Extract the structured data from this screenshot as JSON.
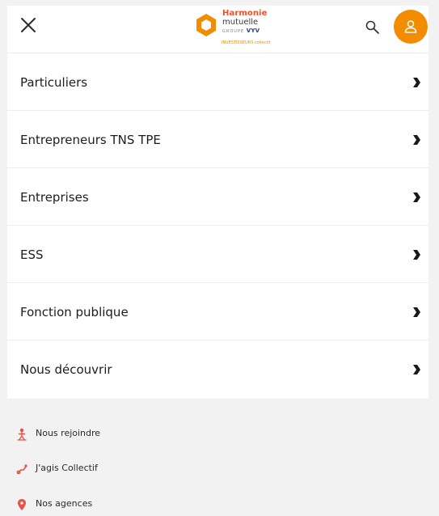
{
  "header": {
    "close_icon": "close-icon",
    "logo": {
      "brand_line1": "Harmonie",
      "brand_line2": "mutuelle",
      "group_prefix": "GROUPE",
      "group_name": "VYV",
      "tagline": "INVESTISSEURS collectif"
    },
    "search_icon": "search-icon",
    "account_icon": "user-icon"
  },
  "menu": {
    "items": [
      {
        "label": "Particuliers"
      },
      {
        "label": "Entrepreneurs TNS TPE"
      },
      {
        "label": "Entreprises"
      },
      {
        "label": "ESS"
      },
      {
        "label": "Fonction publique"
      },
      {
        "label": "Nous découvrir"
      }
    ],
    "chevron_icon": "chevron-right-icon"
  },
  "footer": {
    "links": [
      {
        "label": "Nous rejoindre",
        "icon": "people-icon"
      },
      {
        "label": "J'agis Collectif",
        "icon": "handshake-icon"
      },
      {
        "label": "Nos agences",
        "icon": "map-pin-icon"
      }
    ]
  },
  "colors": {
    "accent": "#f28c00",
    "brand_red": "#ee4f2c",
    "footer_icon": "#e4524a",
    "background": "#f2f2f2"
  }
}
